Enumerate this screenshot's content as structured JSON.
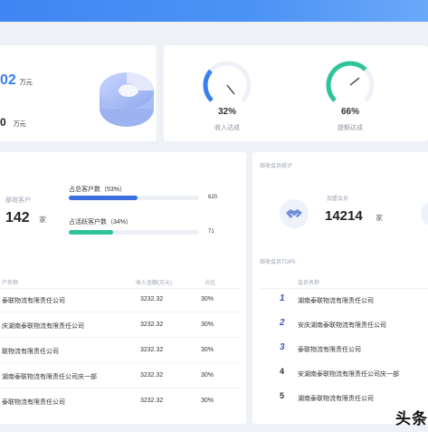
{
  "colors": {
    "accent": "#3f86f2",
    "gauge_blue": "#3a7ff0",
    "gauge_green": "#2ec49b",
    "bar_blue": "#3a6fe0",
    "bar_green": "#2ec49b"
  },
  "summary": {
    "value1": "02",
    "unit1": "万元",
    "value2": "0",
    "unit2": "万元"
  },
  "gauges": [
    {
      "value": "32%",
      "label": "收入达成",
      "fraction": 0.32
    },
    {
      "value": "66%",
      "label": "提额达成",
      "fraction": 0.66
    }
  ],
  "customers": {
    "label": "部收客户",
    "count": "142",
    "unit": "家",
    "bars": [
      {
        "title": "占总客户数（53%）",
        "value": "620",
        "fraction": 0.53
      },
      {
        "title": "占活跃客户数（34%）",
        "value": "71",
        "fraction": 0.34
      }
    ]
  },
  "table": {
    "headers": [
      "户名称",
      "收入金额(万元)",
      "占比"
    ],
    "rows": [
      {
        "name": "泰联物流有限责任公司",
        "amount": "3232.32",
        "ratio": "30%"
      },
      {
        "name": "庆湖南泰联物流有限责任公司",
        "amount": "3232.32",
        "ratio": "30%"
      },
      {
        "name": "联物流有限责任公司",
        "amount": "3232.32",
        "ratio": "30%"
      },
      {
        "name": "湖南泰联物流有限责任公司庆一部",
        "amount": "3232.32",
        "ratio": "30%"
      },
      {
        "name": "泰联物流有限责任公司",
        "amount": "3232.32",
        "ratio": "30%"
      }
    ]
  },
  "members": {
    "section_title": "部收会员统计",
    "label": "加盟会员",
    "count": "14214",
    "unit": "家",
    "top_title": "部收会员TOP5",
    "top_header": "会员名称",
    "top": [
      {
        "rank": "1",
        "name": "湖南泰联物流有限责任公司"
      },
      {
        "rank": "2",
        "name": "安庆湖南泰联物流有限责任公司"
      },
      {
        "rank": "3",
        "name": "泰联物流有限责任公司"
      },
      {
        "rank": "4",
        "name": "安湖南泰联物流有限责任公司庆一部"
      },
      {
        "rank": "5",
        "name": "湖南泰联物流有限责任公司"
      }
    ]
  },
  "watermark": "头条"
}
